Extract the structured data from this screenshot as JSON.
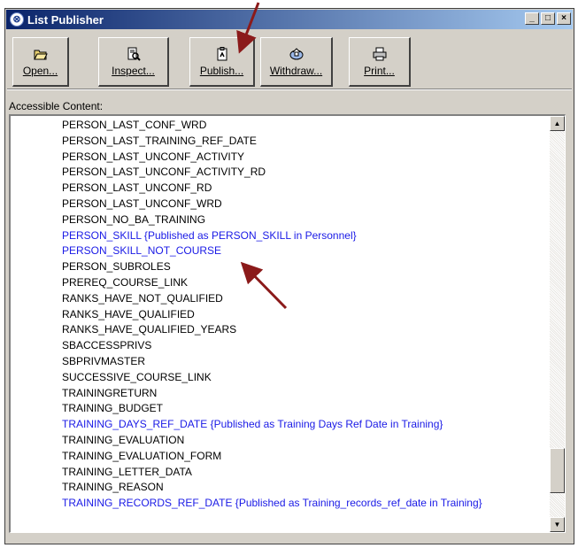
{
  "window": {
    "title": "List Publisher",
    "controls": {
      "minimize": "_",
      "maximize": "□",
      "close": "×"
    }
  },
  "toolbar": {
    "buttons": [
      {
        "label": "Open...",
        "icon": "open-folder-icon"
      },
      {
        "label": "Inspect...",
        "icon": "inspect-icon"
      },
      {
        "label": "Publish...",
        "icon": "publish-icon"
      },
      {
        "label": "Withdraw...",
        "icon": "withdraw-icon"
      },
      {
        "label": "Print...",
        "icon": "printer-icon"
      }
    ]
  },
  "content": {
    "label": "Accessible Content:",
    "items": [
      {
        "text": "PERSON_LAST_CONF_WRD",
        "published": false
      },
      {
        "text": "PERSON_LAST_TRAINING_REF_DATE",
        "published": false
      },
      {
        "text": "PERSON_LAST_UNCONF_ACTIVITY",
        "published": false
      },
      {
        "text": "PERSON_LAST_UNCONF_ACTIVITY_RD",
        "published": false
      },
      {
        "text": "PERSON_LAST_UNCONF_RD",
        "published": false
      },
      {
        "text": "PERSON_LAST_UNCONF_WRD",
        "published": false
      },
      {
        "text": "PERSON_NO_BA_TRAINING",
        "published": false
      },
      {
        "text": "PERSON_SKILL {Published as PERSON_SKILL in Personnel}",
        "published": true
      },
      {
        "text": "PERSON_SKILL_NOT_COURSE",
        "published": true
      },
      {
        "text": "PERSON_SUBROLES",
        "published": false
      },
      {
        "text": "PREREQ_COURSE_LINK",
        "published": false
      },
      {
        "text": "RANKS_HAVE_NOT_QUALIFIED",
        "published": false
      },
      {
        "text": "RANKS_HAVE_QUALIFIED",
        "published": false
      },
      {
        "text": "RANKS_HAVE_QUALIFIED_YEARS",
        "published": false
      },
      {
        "text": "SBACCESSPRIVS",
        "published": false
      },
      {
        "text": "SBPRIVMASTER",
        "published": false
      },
      {
        "text": "SUCCESSIVE_COURSE_LINK",
        "published": false
      },
      {
        "text": "TRAININGRETURN",
        "published": false
      },
      {
        "text": "TRAINING_BUDGET",
        "published": false
      },
      {
        "text": "TRAINING_DAYS_REF_DATE {Published as Training Days Ref Date in Training}",
        "published": true
      },
      {
        "text": "TRAINING_EVALUATION",
        "published": false
      },
      {
        "text": "TRAINING_EVALUATION_FORM",
        "published": false
      },
      {
        "text": "TRAINING_LETTER_DATA",
        "published": false
      },
      {
        "text": "TRAINING_REASON",
        "published": false
      },
      {
        "text": "TRAINING_RECORDS_REF_DATE {Published as Training_records_ref_date in Training}",
        "published": true
      }
    ]
  },
  "colors": {
    "published_text": "#1a1ae6",
    "normal_text": "#000000",
    "annotation_arrow": "#8b1a1a",
    "title_bar": "#0a246a"
  },
  "scrollbar": {
    "up_icon": "scroll-up-arrow-icon",
    "down_icon": "scroll-down-arrow-icon"
  }
}
